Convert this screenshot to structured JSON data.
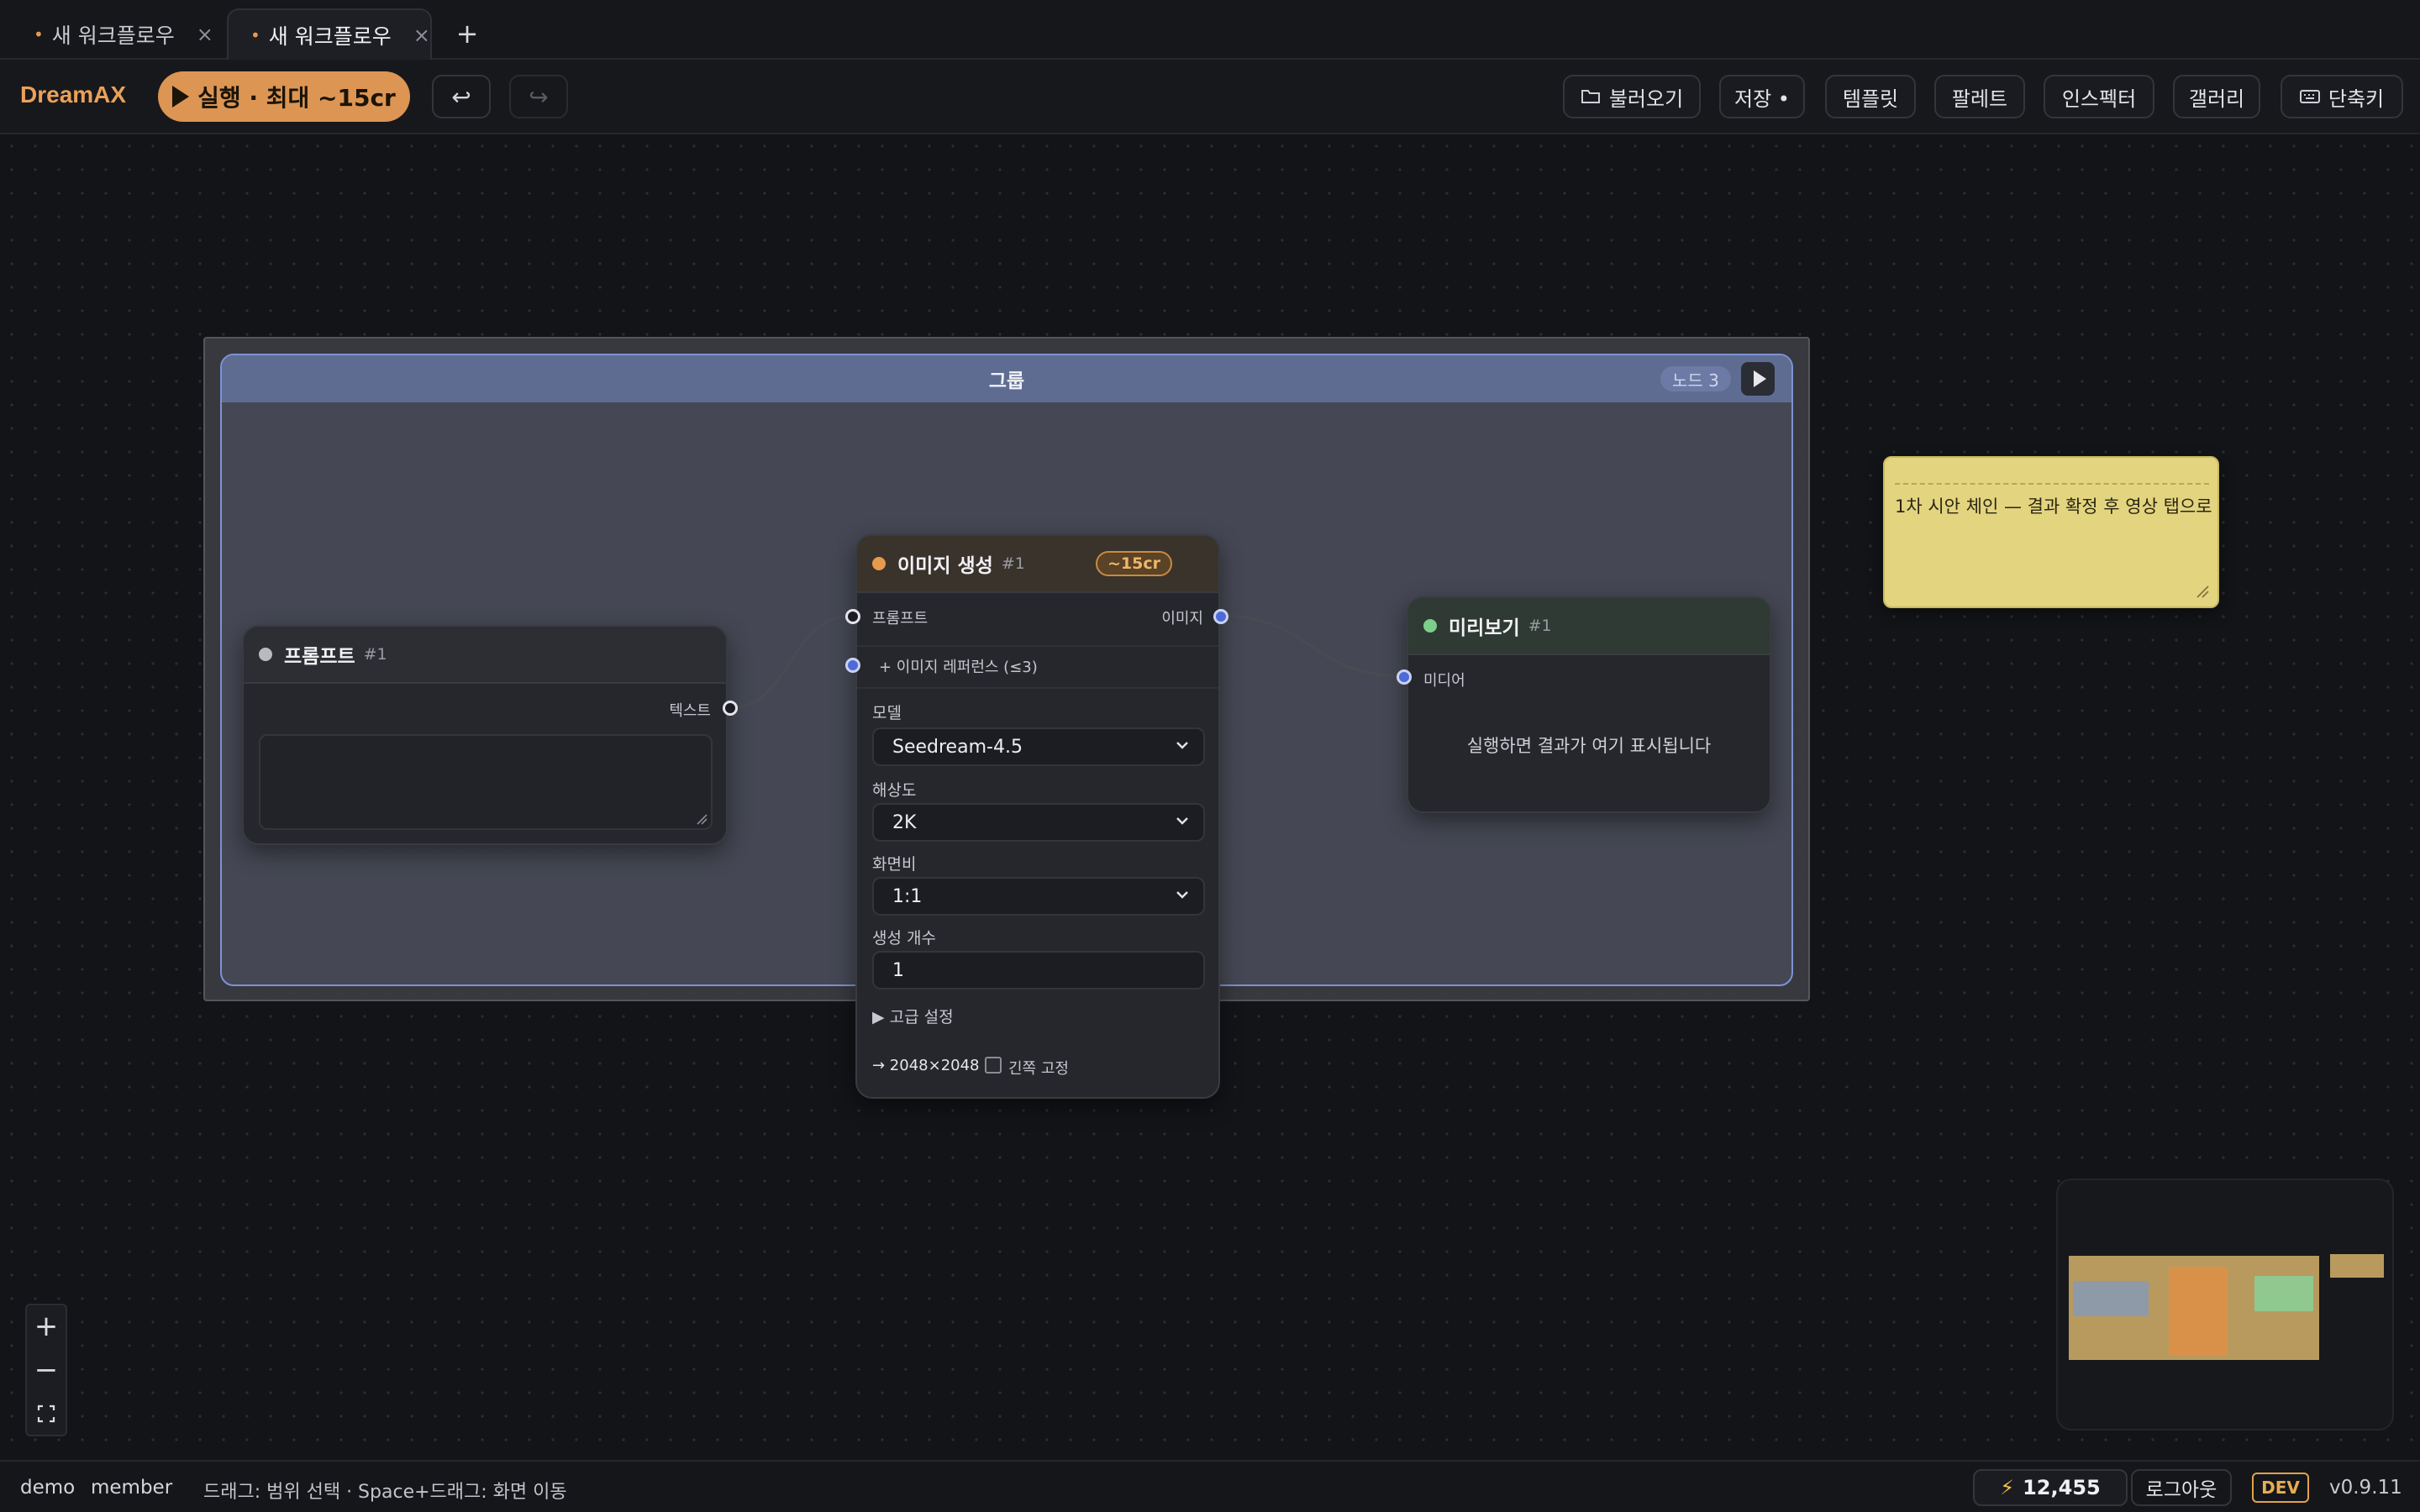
{
  "tabs": [
    {
      "label": "새 워크플로우",
      "modified_dot": "•",
      "close": "×"
    },
    {
      "label": "새 워크플로우",
      "modified_dot": "•",
      "close": "×"
    }
  ],
  "tab_add": "+",
  "toolbar": {
    "brand": "DreamAX",
    "run_label": "실행 · 최대 ~15cr",
    "undo": "↩",
    "redo": "↪",
    "buttons": {
      "load": "불러오기",
      "save": "저장 •",
      "template": "템플릿",
      "palette": "팔레트",
      "inspector": "인스펙터",
      "gallery": "갤러리",
      "shortcuts": "단축키"
    }
  },
  "group": {
    "title": "그룹",
    "badge": "노드 3"
  },
  "prompt_node": {
    "title": "프롬프트",
    "num": "#1",
    "output_label": "텍스트",
    "status_color": "#b9bac0"
  },
  "image_gen_node": {
    "title": "이미지 생성",
    "num": "#1",
    "cost": "~15cr",
    "status_color": "#e79a4e",
    "input_prompt": "프롬프트",
    "output_image": "이미지",
    "input_reference": "+ 이미지 레퍼런스 (≤3)",
    "model_label": "모델",
    "model_value": "Seedream-4.5",
    "resolution_label": "해상도",
    "resolution_value": "2K",
    "aspect_label": "화면비",
    "aspect_value": "1:1",
    "count_label": "생성 개수",
    "count_value": "1",
    "advanced": "▶ 고급 설정",
    "output_size": "→ 2048×2048",
    "lock_label": "긴쪽 고정"
  },
  "preview_node": {
    "title": "미리보기",
    "num": "#1",
    "input_label": "미디어",
    "placeholder": "실행하면 결과가 여기 표시됩니다",
    "status_color": "#7ccf8a"
  },
  "sticky_note": {
    "text": "1차 시안 체인 — 결과 확정 후 영상 탭으로"
  },
  "zoom": {
    "in": "+",
    "out": "−"
  },
  "statusbar": {
    "user": "demo",
    "role": "member",
    "hint": "드래그: 범위 선택 · Space+드래그: 화면 이동",
    "credits": "12,455",
    "bolt": "⚡",
    "logout": "로그아웃",
    "env": "DEV",
    "version": "v0.9.11"
  },
  "colors": {
    "accent": "#dc9553",
    "group_border": "#7c93d6",
    "sticky": "#e3d47f"
  }
}
